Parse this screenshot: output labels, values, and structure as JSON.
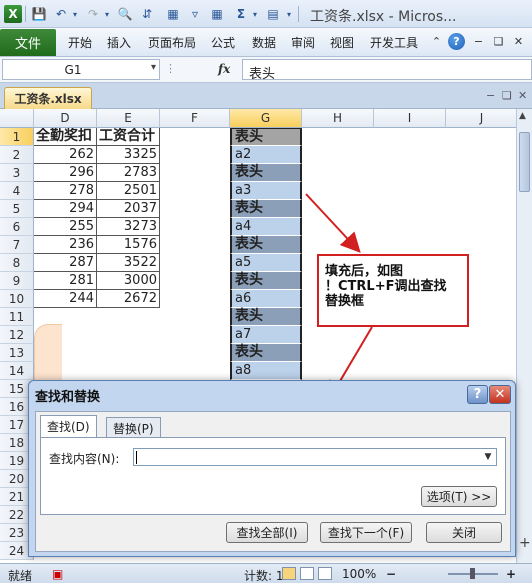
{
  "window": {
    "title": "工资条.xlsx - Micros..."
  },
  "ribbon": {
    "file_tab": "文件",
    "tabs": [
      "开始",
      "插入",
      "页面布局",
      "公式",
      "数据",
      "审阅",
      "视图",
      "开发工具"
    ]
  },
  "formula_bar": {
    "name_box": "G1",
    "fx_label": "fx",
    "value": "表头"
  },
  "workbook": {
    "tab": "工资条.xlsx"
  },
  "grid": {
    "columns": [
      "D",
      "E",
      "F",
      "G",
      "H",
      "I",
      "J"
    ],
    "selected_column": "G",
    "rows": [
      "1",
      "2",
      "3",
      "4",
      "5",
      "6",
      "7",
      "8",
      "9",
      "10",
      "11",
      "12",
      "13",
      "14",
      "15",
      "16",
      "17",
      "18",
      "19",
      "20",
      "21",
      "22",
      "23",
      "24"
    ],
    "selected_row": "1",
    "headers": {
      "d": "全勤奖扣",
      "e": "工资合计"
    },
    "d_values": [
      "262",
      "296",
      "278",
      "294",
      "255",
      "236",
      "287",
      "281",
      "244"
    ],
    "e_values": [
      "3325",
      "2783",
      "2501",
      "2037",
      "3273",
      "1576",
      "3522",
      "3000",
      "2672"
    ],
    "g_values": [
      "表头",
      "a2",
      "表头",
      "a3",
      "表头",
      "a4",
      "表头",
      "a5",
      "表头",
      "a6",
      "表头",
      "a7",
      "表头",
      "a8"
    ]
  },
  "callout": {
    "lines": [
      "填充后，如图",
      "！CTRL+F调出查找",
      "替换框"
    ]
  },
  "dialog": {
    "title": "查找和替换",
    "help": "?",
    "close": "✕",
    "tabs": [
      "查找(D)",
      "替换(P)"
    ],
    "find_label": "查找内容(N):",
    "find_value": "",
    "options_button": "选项(T) >>",
    "find_all_button": "查找全部(I)",
    "find_next_button": "查找下一个(F)",
    "close_button": "关闭"
  },
  "status_bar": {
    "ready": "就绪",
    "count": "计数: 18",
    "zoom": "100%"
  }
}
